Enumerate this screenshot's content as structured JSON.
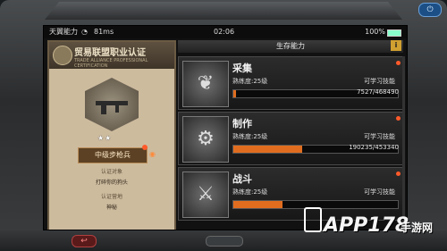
{
  "statusbar": {
    "carrier": "天翼能力",
    "speed": "81ms",
    "time": "02:06",
    "battery": "100%"
  },
  "card": {
    "title": "贸易联盟职业认证",
    "subtitle": "TRADE ALLIANCE PROFESSIONAL CERTIFICATION",
    "stars": "★★",
    "rank": "中级步枪兵",
    "object_label": "认证对象",
    "object_value": "打碎你的狗头",
    "place_label": "认证营地",
    "place_value": "神秘"
  },
  "panel": {
    "title": "生存能力",
    "info": "i"
  },
  "skills": [
    {
      "name": "采集",
      "level": "熟练度:25级",
      "learn": "可学习技能",
      "count": "7527/468490",
      "progress": 0.016,
      "icon": "gather-icon"
    },
    {
      "name": "制作",
      "level": "熟练度:25级",
      "learn": "可学习技能",
      "count": "190235/453340",
      "progress": 0.42,
      "icon": "craft-icon"
    },
    {
      "name": "战斗",
      "level": "熟练度:25级",
      "learn": "可学习技能",
      "count": "",
      "progress": 0.3,
      "icon": "combat-icon"
    }
  ],
  "watermark": {
    "logo": "APP178",
    "site": "手游网"
  },
  "colors": {
    "progress": "#e06d1f",
    "notify": "#ff5a2a"
  }
}
